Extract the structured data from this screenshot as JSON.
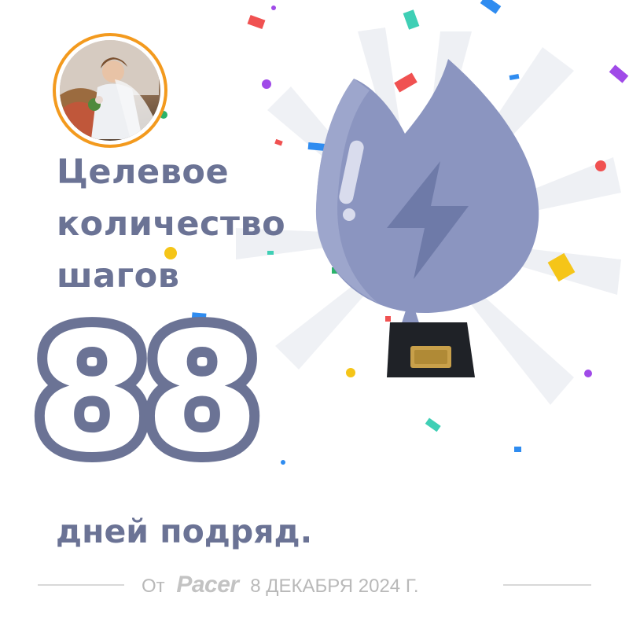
{
  "title_lines": [
    "Целевое",
    "количество",
    "шагов"
  ],
  "streak_count": "88",
  "subtitle": "дней подряд.",
  "footer": {
    "prefix": "От",
    "brand": "Pacer",
    "date": "8 ДЕКАБРЯ 2024 Г."
  },
  "colors": {
    "primary": "#6b7395",
    "trophy": "#8b95c0",
    "avatar_ring": "#f39a1e",
    "plaque": "#c8a04a",
    "base": "#1f2227"
  },
  "icons": {
    "trophy": "flame-trophy-icon",
    "bolt": "lightning-bolt-icon",
    "avatar": "user-avatar"
  }
}
